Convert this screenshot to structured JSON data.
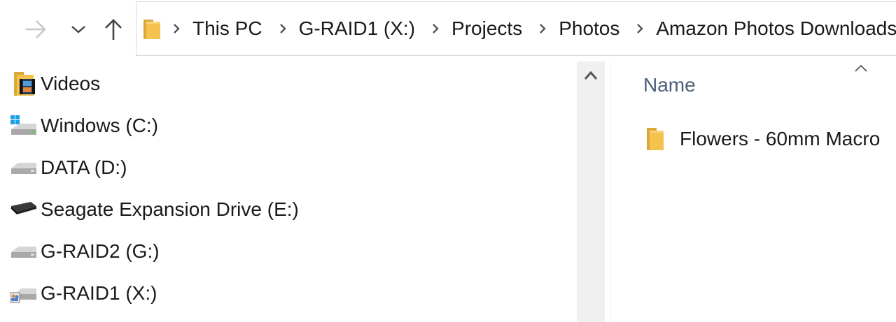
{
  "toolbar": {
    "forward_icon": "arrow-right-icon",
    "recent_icon": "chevron-down-icon",
    "up_icon": "arrow-up-icon"
  },
  "address": {
    "crumbs": [
      "This PC",
      "G-RAID1 (X:)",
      "Projects",
      "Photos",
      "Amazon Photos Downloads"
    ]
  },
  "nav": {
    "items": [
      {
        "label": "Videos",
        "icon": "videos-folder-icon"
      },
      {
        "label": "Windows  (C:)",
        "icon": "windows-drive-icon"
      },
      {
        "label": "DATA (D:)",
        "icon": "drive-icon"
      },
      {
        "label": "Seagate Expansion Drive (E:)",
        "icon": "external-drive-icon"
      },
      {
        "label": "G-RAID2 (G:)",
        "icon": "drive-icon"
      },
      {
        "label": "G-RAID1 (X:)",
        "icon": "network-drive-icon"
      }
    ]
  },
  "content": {
    "column_name": "Name",
    "files": [
      {
        "name": "Flowers - 60mm Macro",
        "icon": "folder-icon"
      }
    ]
  },
  "colors": {
    "folder_yellow": "#f4c24d",
    "header_text": "#4c607a",
    "scrollbar_bg": "#f0f0f0"
  }
}
